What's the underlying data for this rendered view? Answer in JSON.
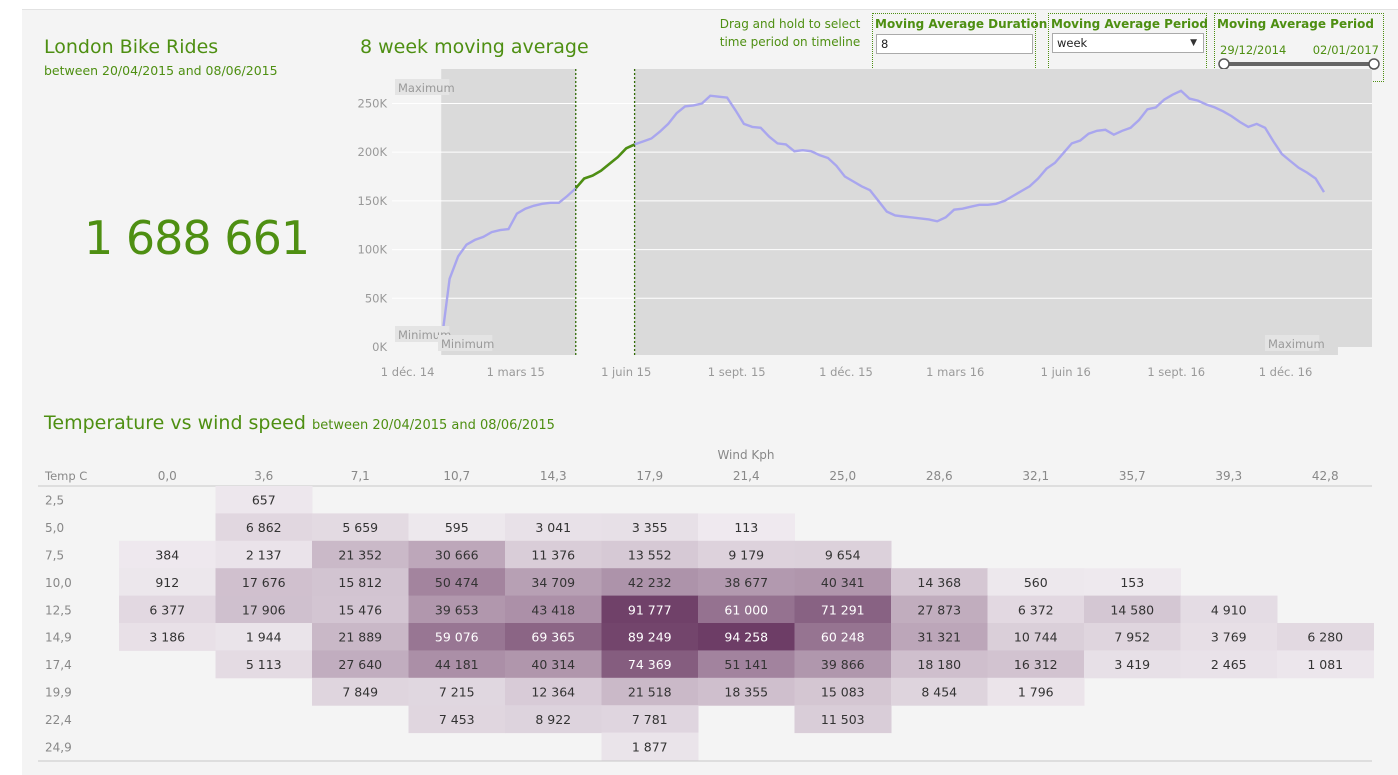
{
  "kpi": {
    "title": "London Bike Rides",
    "subtitle": "between 20/04/2015 and 08/06/2015",
    "total": "1 688 661"
  },
  "controls": {
    "hint": "Drag and hold to select time period on timeline",
    "duration_label": "Moving Average Duration",
    "duration_value": "8",
    "period_label": "Moving Average Period",
    "period_value": "week",
    "range_label": "Moving Average Period",
    "range_start": "29/12/2014",
    "range_end": "02/01/2017"
  },
  "colors": {
    "accent": "#4e8f12",
    "line": "#a9a6ee",
    "selected_line": "#4e8f12",
    "heat_low": "#efeaef",
    "heat_high": "#6d3d66"
  },
  "chart_data": [
    {
      "type": "line",
      "title": "8 week moving average",
      "ylim": [
        0,
        270000
      ],
      "yticks": [
        "250K",
        "200K",
        "150K",
        "100K",
        "50K",
        "0K"
      ],
      "ytick_values": [
        250000,
        200000,
        150000,
        100000,
        50000,
        0
      ],
      "xticks": [
        "1 déc. 14",
        "1 mars 15",
        "1 juin 15",
        "1 sept. 15",
        "1 déc. 15",
        "1 mars 16",
        "1 juin 16",
        "1 sept. 16",
        "1 déc. 16"
      ],
      "xtick_dates": [
        "2014-12-01",
        "2015-03-01",
        "2015-06-01",
        "2015-09-01",
        "2015-12-01",
        "2016-03-01",
        "2016-06-01",
        "2016-09-01",
        "2016-12-01"
      ],
      "band_labels": {
        "max_top": "Maximum",
        "min_left": "Minimum",
        "min_bottom": "Minimum",
        "max_right": "Maximum"
      },
      "selection": [
        "2015-04-20",
        "2015-06-08"
      ],
      "x": [
        "2014-12-29",
        "2015-01-05",
        "2015-01-12",
        "2015-01-19",
        "2015-01-26",
        "2015-02-02",
        "2015-02-09",
        "2015-02-16",
        "2015-02-23",
        "2015-03-02",
        "2015-03-09",
        "2015-03-16",
        "2015-03-23",
        "2015-03-30",
        "2015-04-06",
        "2015-04-13",
        "2015-04-20",
        "2015-04-27",
        "2015-05-04",
        "2015-05-11",
        "2015-05-18",
        "2015-05-25",
        "2015-06-01",
        "2015-06-08",
        "2015-06-15",
        "2015-06-22",
        "2015-06-29",
        "2015-07-06",
        "2015-07-13",
        "2015-07-20",
        "2015-07-27",
        "2015-08-03",
        "2015-08-10",
        "2015-08-17",
        "2015-08-24",
        "2015-08-31",
        "2015-09-07",
        "2015-09-14",
        "2015-09-21",
        "2015-09-28",
        "2015-10-05",
        "2015-10-12",
        "2015-10-19",
        "2015-10-26",
        "2015-11-02",
        "2015-11-09",
        "2015-11-16",
        "2015-11-23",
        "2015-11-30",
        "2015-12-07",
        "2015-12-14",
        "2015-12-21",
        "2015-12-28",
        "2016-01-04",
        "2016-01-11",
        "2016-01-18",
        "2016-01-25",
        "2016-02-01",
        "2016-02-08",
        "2016-02-15",
        "2016-02-22",
        "2016-02-29",
        "2016-03-07",
        "2016-03-14",
        "2016-03-21",
        "2016-03-28",
        "2016-04-04",
        "2016-04-11",
        "2016-04-18",
        "2016-04-25",
        "2016-05-02",
        "2016-05-09",
        "2016-05-16",
        "2016-05-23",
        "2016-05-30",
        "2016-06-06",
        "2016-06-13",
        "2016-06-20",
        "2016-06-27",
        "2016-07-04",
        "2016-07-11",
        "2016-07-18",
        "2016-07-25",
        "2016-08-01",
        "2016-08-08",
        "2016-08-15",
        "2016-08-22",
        "2016-08-29",
        "2016-09-05",
        "2016-09-12",
        "2016-09-19",
        "2016-09-26",
        "2016-10-03",
        "2016-10-10",
        "2016-10-17",
        "2016-10-24",
        "2016-10-31",
        "2016-11-07",
        "2016-11-14",
        "2016-11-21",
        "2016-11-28",
        "2016-12-05",
        "2016-12-12",
        "2016-12-19",
        "2016-12-26",
        "2017-01-02"
      ],
      "y": [
        3000,
        70000,
        93000,
        105000,
        110000,
        113000,
        118000,
        120000,
        121000,
        137000,
        142000,
        145000,
        147000,
        148000,
        148000,
        155000,
        163000,
        173000,
        176000,
        181000,
        188000,
        195000,
        204000,
        208000,
        211000,
        214000,
        221000,
        229000,
        240000,
        247000,
        248000,
        250000,
        258000,
        257000,
        256000,
        243000,
        229000,
        226000,
        225000,
        216000,
        209000,
        208000,
        201000,
        202000,
        201000,
        197000,
        194000,
        186000,
        175000,
        170000,
        165000,
        161000,
        150000,
        139000,
        135000,
        134000,
        133000,
        132000,
        131000,
        129000,
        133000,
        141000,
        142000,
        144000,
        146000,
        146000,
        147000,
        150000,
        155000,
        160000,
        165000,
        173000,
        183000,
        189000,
        199000,
        209000,
        212000,
        219000,
        222000,
        223000,
        218000,
        222000,
        225000,
        233000,
        244000,
        246000,
        254000,
        259000,
        263000,
        255000,
        253000,
        249000,
        246000,
        242000,
        237000,
        231000,
        226000,
        229000,
        225000,
        211000,
        198000,
        191000,
        184000,
        179000,
        173000,
        159000
      ],
      "grid": true
    },
    {
      "type": "heatmap",
      "title": "Temperature vs wind speed",
      "subtitle": "between 20/04/2015 and 08/06/2015",
      "xlabel": "Wind Kph",
      "ylabel": "Temp C",
      "x": [
        "0,0",
        "3,6",
        "7,1",
        "10,7",
        "14,3",
        "17,9",
        "21,4",
        "25,0",
        "28,6",
        "32,1",
        "35,7",
        "39,3",
        "42,8"
      ],
      "y": [
        "2,5",
        "5,0",
        "7,5",
        "10,0",
        "12,5",
        "14,9",
        "17,4",
        "19,9",
        "22,4",
        "24,9"
      ],
      "values": [
        [
          null,
          657,
          null,
          null,
          null,
          null,
          null,
          null,
          null,
          null,
          null,
          null,
          null
        ],
        [
          null,
          6862,
          5659,
          595,
          3041,
          3355,
          113,
          null,
          null,
          null,
          null,
          null,
          null
        ],
        [
          384,
          2137,
          21352,
          30666,
          11376,
          13552,
          9179,
          9654,
          null,
          null,
          null,
          null,
          null
        ],
        [
          912,
          17676,
          15812,
          50474,
          34709,
          42232,
          38677,
          40341,
          14368,
          560,
          153,
          null,
          null
        ],
        [
          6377,
          17906,
          15476,
          39653,
          43418,
          91777,
          61000,
          71291,
          27873,
          6372,
          14580,
          4910,
          null
        ],
        [
          3186,
          1944,
          21889,
          59076,
          69365,
          89249,
          94258,
          60248,
          31321,
          10744,
          7952,
          3769,
          6280
        ],
        [
          null,
          5113,
          27640,
          44181,
          40314,
          74369,
          51141,
          39866,
          18180,
          16312,
          3419,
          2465,
          1081
        ],
        [
          null,
          null,
          7849,
          7215,
          12364,
          21518,
          18355,
          15083,
          8454,
          1796,
          null,
          null,
          null
        ],
        [
          null,
          null,
          null,
          7453,
          8922,
          7781,
          null,
          11503,
          null,
          null,
          null,
          null,
          null
        ],
        [
          null,
          null,
          null,
          null,
          null,
          1877,
          null,
          null,
          null,
          null,
          null,
          null,
          null
        ]
      ]
    }
  ]
}
